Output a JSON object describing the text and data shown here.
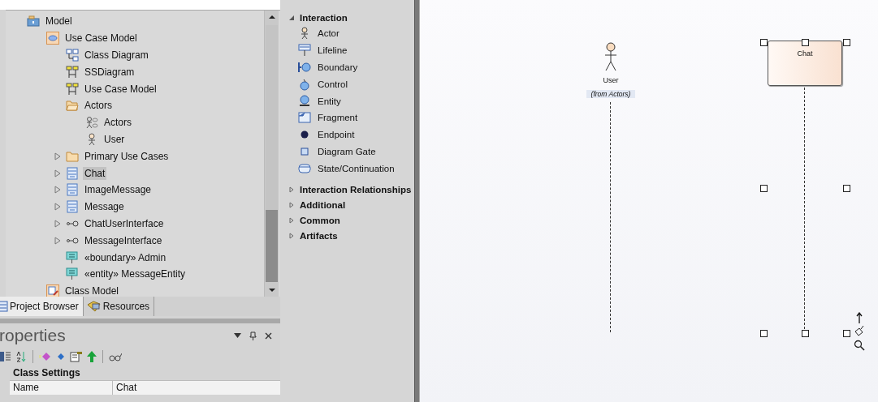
{
  "project_browser": {
    "tree": [
      {
        "label": "Model",
        "kind": "root",
        "selected": false,
        "expanded": true,
        "children": [
          {
            "label": "Use Case Model",
            "kind": "usecase-package",
            "selected": false,
            "expanded": true,
            "children": [
              {
                "label": "Class Diagram",
                "kind": "class-diagram",
                "selected": false
              },
              {
                "label": "SSDiagram",
                "kind": "diagram",
                "selected": false
              },
              {
                "label": "Use Case Model",
                "kind": "diagram",
                "selected": false
              },
              {
                "label": "Actors",
                "kind": "open-folder",
                "selected": false,
                "expanded": true,
                "children": [
                  {
                    "label": "Actors",
                    "kind": "actors-diagram",
                    "selected": false
                  },
                  {
                    "label": "User",
                    "kind": "actor",
                    "selected": false
                  }
                ]
              },
              {
                "label": "Primary Use Cases",
                "kind": "folder",
                "selected": false,
                "expanded": false
              },
              {
                "label": "Chat",
                "kind": "class",
                "selected": true,
                "expanded": false
              },
              {
                "label": "ImageMessage",
                "kind": "class",
                "selected": false,
                "expanded": false
              },
              {
                "label": "Message",
                "kind": "class",
                "selected": false,
                "expanded": false
              },
              {
                "label": "ChatUserInterface",
                "kind": "interface",
                "selected": false,
                "expanded": false
              },
              {
                "label": "MessageInterface",
                "kind": "interface",
                "selected": false,
                "expanded": false
              },
              {
                "label": "«boundary» Admin",
                "kind": "stereotyped",
                "selected": false
              },
              {
                "label": "«entity» MessageEntity",
                "kind": "stereotyped",
                "selected": false
              }
            ]
          },
          {
            "label": "Class Model",
            "kind": "class-package",
            "selected": false
          }
        ]
      }
    ],
    "tabs": [
      {
        "label": "Project Browser",
        "selected": true
      },
      {
        "label": "Resources",
        "selected": false
      }
    ]
  },
  "properties": {
    "title": "roperties",
    "section": "Class Settings",
    "rows": [
      {
        "name": "Name",
        "value": "Chat"
      }
    ]
  },
  "toolbox": {
    "sections": [
      {
        "label": "Interaction",
        "expanded": true,
        "items": [
          {
            "label": "Actor",
            "kind": "actor"
          },
          {
            "label": "Lifeline",
            "kind": "lifeline"
          },
          {
            "label": "Boundary",
            "kind": "boundary"
          },
          {
            "label": "Control",
            "kind": "control"
          },
          {
            "label": "Entity",
            "kind": "entity"
          },
          {
            "label": "Fragment",
            "kind": "fragment"
          },
          {
            "label": "Endpoint",
            "kind": "endpoint"
          },
          {
            "label": "Diagram Gate",
            "kind": "gate"
          },
          {
            "label": "State/Continuation",
            "kind": "state"
          }
        ]
      },
      {
        "label": "Interaction Relationships",
        "expanded": false
      },
      {
        "label": "Additional",
        "expanded": false
      },
      {
        "label": "Common",
        "expanded": false
      },
      {
        "label": "Artifacts",
        "expanded": false
      }
    ]
  },
  "diagram": {
    "lifelines": [
      {
        "kind": "actor",
        "name": "User",
        "note": "(from Actors)",
        "selected": false
      },
      {
        "kind": "object",
        "name": "Chat",
        "selected": true
      }
    ]
  }
}
